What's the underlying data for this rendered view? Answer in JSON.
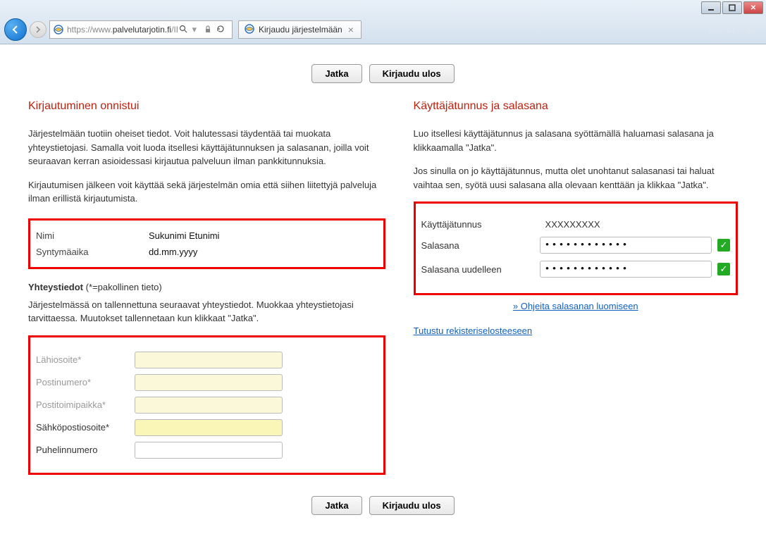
{
  "browser": {
    "url_proto": "https://",
    "url_prefix": "www.",
    "url_domain": "palvelutarjotin.fi",
    "url_path": "/IDF",
    "tab_title": "Kirjaudu järjestelmään"
  },
  "buttons": {
    "continue": "Jatka",
    "logout": "Kirjaudu ulos"
  },
  "left": {
    "heading": "Kirjautuminen onnistui",
    "para1": "Järjestelmään tuotiin oheiset tiedot. Voit halutessasi täydentää tai muokata yhteystietojasi. Samalla voit luoda itsellesi käyttäjätunnuksen ja salasanan, joilla voit seuraavan kerran asioidessasi kirjautua palveluun ilman pankkitunnuksia.",
    "para2": "Kirjautumisen jälkeen voit käyttää sekä järjestelmän omia että siihen liitettyjä palveluja ilman erillistä kirjautumista.",
    "info": {
      "name_label": "Nimi",
      "name_value": "Sukunimi Etunimi",
      "dob_label": "Syntymäaika",
      "dob_value": "dd.mm.yyyy"
    },
    "contact_heading": "Yhteystiedot",
    "contact_req": " (*=pakollinen tieto)",
    "contact_desc": "Järjestelmässä on tallennettuna seuraavat yhteystiedot. Muokkaa yhteystietojasi tarvittaessa. Muutokset tallennetaan kun klikkaat \"Jatka\".",
    "fields": {
      "address": "Lähiosoite*",
      "postcode": "Postinumero*",
      "city": "Postitoimipaikka*",
      "email": "Sähköpostiosoite*",
      "phone": "Puhelinnumero"
    }
  },
  "right": {
    "heading": "Käyttäjätunnus ja salasana",
    "para1": "Luo itsellesi käyttäjätunnus ja salasana syöttämällä haluamasi salasana ja klikkaamalla \"Jatka\".",
    "para2": "Jos sinulla on jo käyttäjätunnus, mutta olet unohtanut salasanasi tai haluat vaihtaa sen, syötä uusi salasana alla olevaan kenttään ja klikkaa \"Jatka\".",
    "user_label": "Käyttäjätunnus",
    "user_value": "XXXXXXXXX",
    "pw_label": "Salasana",
    "pw2_label": "Salasana uudelleen",
    "pw_value": "●●●●●●●●●●●●",
    "help_link": "» Ohjeita salasanan luomiseen",
    "privacy_link": "Tutustu rekisteriselosteeseen"
  }
}
